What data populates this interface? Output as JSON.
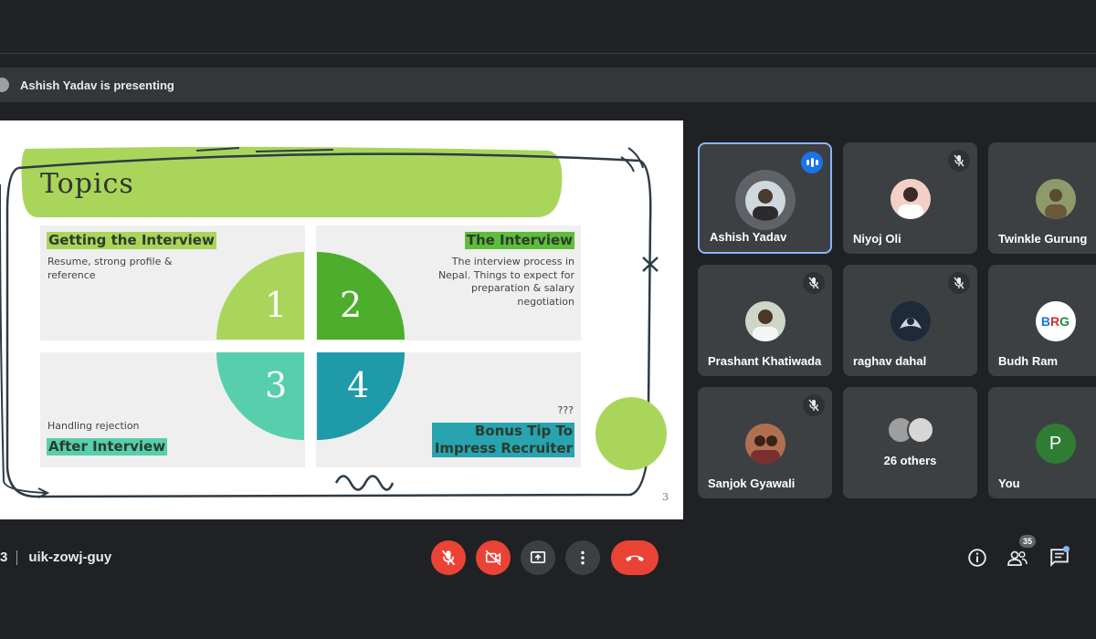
{
  "presenting_bar": {
    "text": "Ashish Yadav is presenting"
  },
  "slide": {
    "title": "Topics",
    "page_number": "3",
    "quadrants": [
      {
        "number": "1",
        "heading": "Getting the Interview",
        "description": "Resume, strong profile & reference",
        "color": "#a9d65a"
      },
      {
        "number": "2",
        "heading": "The Interview",
        "description": "The interview process in Nepal. Things to expect for preparation & salary negotiation",
        "color": "#4cae2c"
      },
      {
        "number": "3",
        "heading": "After Interview",
        "description": "Handling rejection",
        "color": "#57cfad"
      },
      {
        "number": "4",
        "heading": "Bonus Tip To Impress Recruiter",
        "description": "???",
        "color": "#1f9aa8"
      }
    ]
  },
  "participants": [
    {
      "name": "Ashish Yadav",
      "state": "speaking",
      "avatar": "photo",
      "avatar_color": "#cfd8dc"
    },
    {
      "name": "Niyoj Oli",
      "state": "muted",
      "avatar": "photo",
      "avatar_color": "#f2d0c8"
    },
    {
      "name": "Twinkle Gurung",
      "state": "unmuted",
      "avatar": "photo",
      "avatar_color": "#8d9a6a"
    },
    {
      "name": "Prashant Khatiwada",
      "state": "muted",
      "avatar": "photo",
      "avatar_color": "#cfd6c8"
    },
    {
      "name": "raghav dahal",
      "state": "muted",
      "avatar": "photo",
      "avatar_color": "#1e2a3a"
    },
    {
      "name": "Budh Ram",
      "state": "unmuted",
      "avatar": "BRG",
      "avatar_color": "#ffffff"
    },
    {
      "name": "Sanjok Gyawali",
      "state": "muted",
      "avatar": "photo",
      "avatar_color": "#b07050"
    },
    {
      "name": "26 others",
      "state": "group",
      "avatar": "group",
      "avatar_color": "#9e9e9e"
    },
    {
      "name": "You",
      "state": "self",
      "avatar": "P",
      "avatar_color": "#2e7d32"
    }
  ],
  "footer": {
    "time_fragment": "3",
    "meeting_code": "uik-zowj-guy",
    "people_count": "35"
  },
  "colors": {
    "mic_off": "#ea4335",
    "accent": "#8ab4f8",
    "end_call": "#ea4335"
  },
  "icons": [
    "mic-off-icon",
    "camera-off-icon",
    "present-icon",
    "more-icon",
    "end-call-icon",
    "info-icon",
    "people-icon",
    "chat-icon"
  ]
}
